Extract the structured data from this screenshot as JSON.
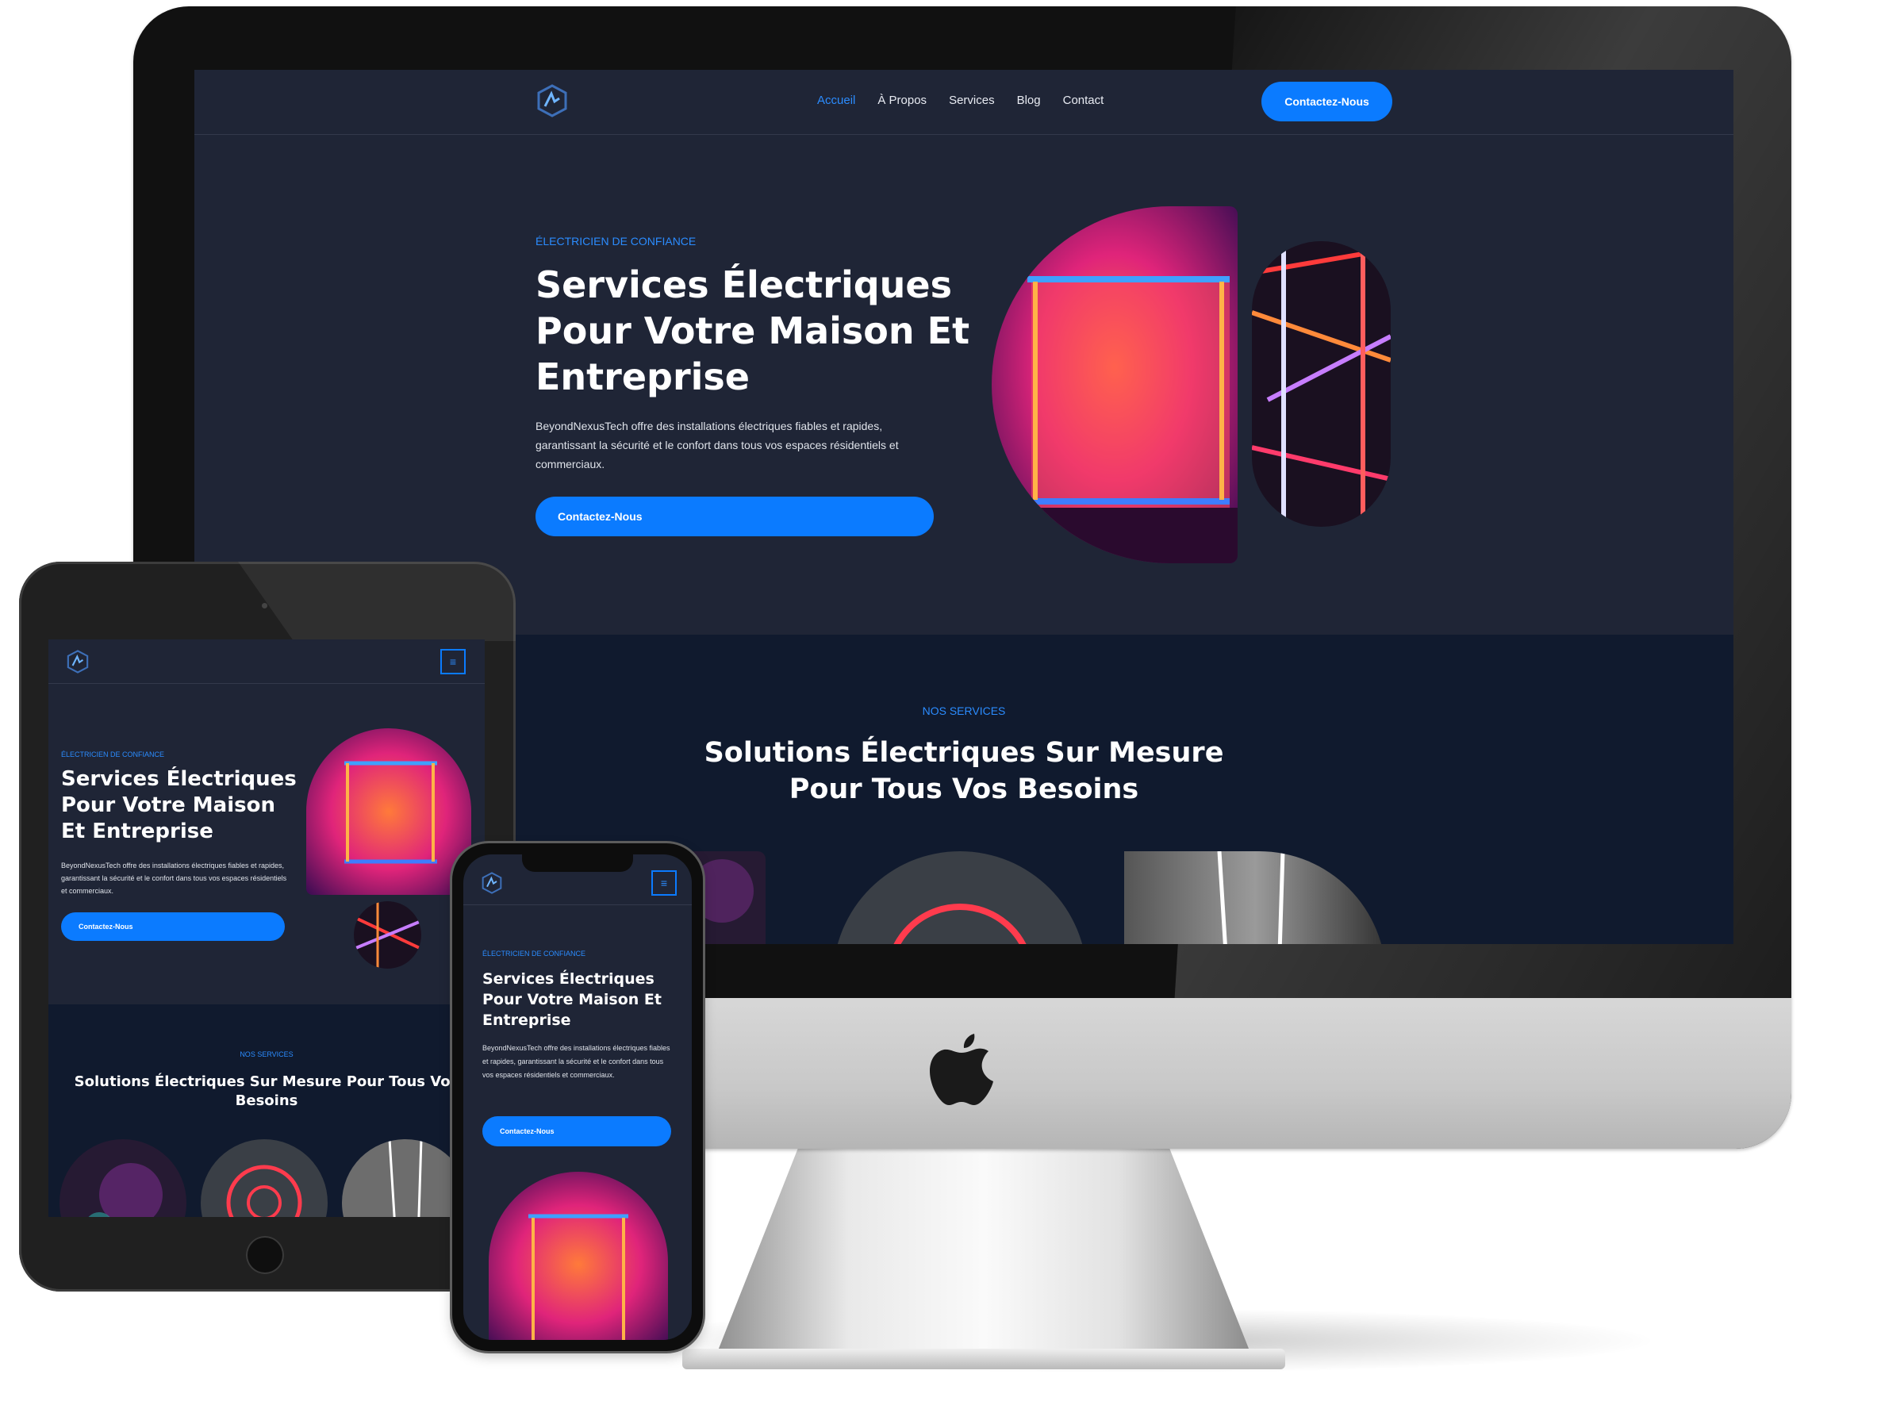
{
  "site": {
    "nav": {
      "items": [
        "Accueil",
        "À Propos",
        "Services",
        "Blog",
        "Contact"
      ],
      "active_index": 0,
      "cta_label": "Contactez-Nous",
      "menu_icon": "hamburger-icon"
    },
    "hero": {
      "eyebrow": "ÉLECTRICIEN DE CONFIANCE",
      "title": "Services Électriques Pour Votre Maison Et Entreprise",
      "description": "BeyondNexusTech offre des installations électriques fiables et rapides, garantissant la sécurité et le confort dans tous vos espaces résidentiels et commerciaux.",
      "cta_label": "Contactez-Nous"
    },
    "services": {
      "eyebrow": "NOS SERVICES",
      "title": "Solutions Électriques Sur Mesure Pour Tous Vos Besoins"
    }
  },
  "colors": {
    "page_bg": "#1f2536",
    "services_bg": "#101a2e",
    "accent": "#0b7bff",
    "text": "#ffffff"
  },
  "icons": [
    "logo-icon",
    "hamburger-icon",
    "apple-logo-icon"
  ]
}
